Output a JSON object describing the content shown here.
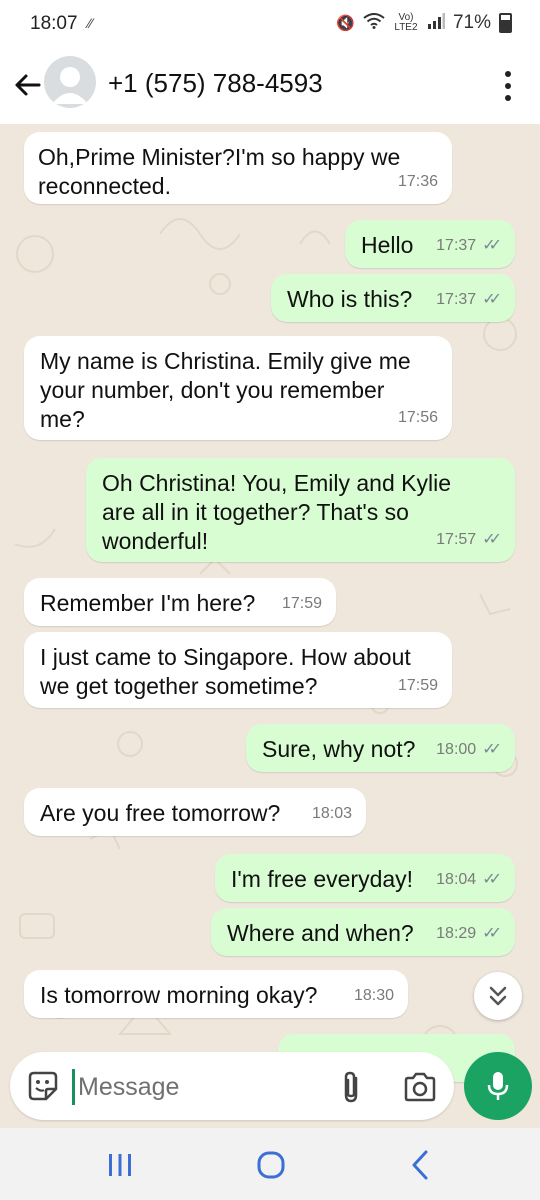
{
  "status_bar": {
    "time": "18:07",
    "battery": "71%",
    "network_label": "Vo) LTE2"
  },
  "header": {
    "contact": "+1 (575) 788-4593",
    "back_icon": "arrow-left-icon",
    "menu_icon": "more-vertical-icon"
  },
  "messages": [
    {
      "dir": "in",
      "text": "Oh,Prime Minister?I'm so happy we reconnected.",
      "time": "17:36"
    },
    {
      "dir": "out",
      "text": "Hello",
      "time": "17:37",
      "ticks": "✓✓"
    },
    {
      "dir": "out",
      "text": "Who is this?",
      "time": "17:37",
      "ticks": "✓✓"
    },
    {
      "dir": "in",
      "text": "My name is Christina. Emily give me your number, don't you remember me?",
      "time": "17:56"
    },
    {
      "dir": "out",
      "text": "Oh Christina! You, Emily and Kylie are all in it together? That's so wonderful!",
      "time": "17:57",
      "ticks": "✓✓"
    },
    {
      "dir": "in",
      "text": "Remember I'm here?",
      "time": "17:59"
    },
    {
      "dir": "in",
      "text": "I just came to Singapore. How about we get together sometime?",
      "time": "17:59"
    },
    {
      "dir": "out",
      "text": "Sure, why not?",
      "time": "18:00",
      "ticks": "✓✓"
    },
    {
      "dir": "in",
      "text": "Are you free tomorrow?",
      "time": "18:03"
    },
    {
      "dir": "out",
      "text": "I'm free everyday!",
      "time": "18:04",
      "ticks": "✓✓"
    },
    {
      "dir": "out",
      "text": "Where and when?",
      "time": "18:29",
      "ticks": "✓✓"
    },
    {
      "dir": "in",
      "text": "Is tomorrow morning okay?",
      "time": "18:30"
    }
  ],
  "composer": {
    "placeholder": "Message",
    "value": ""
  },
  "colors": {
    "outgoing_bubble": "#d9fdd3",
    "incoming_bubble": "#ffffff",
    "chat_background": "#efe7dc",
    "mic_button": "#1aa363"
  }
}
